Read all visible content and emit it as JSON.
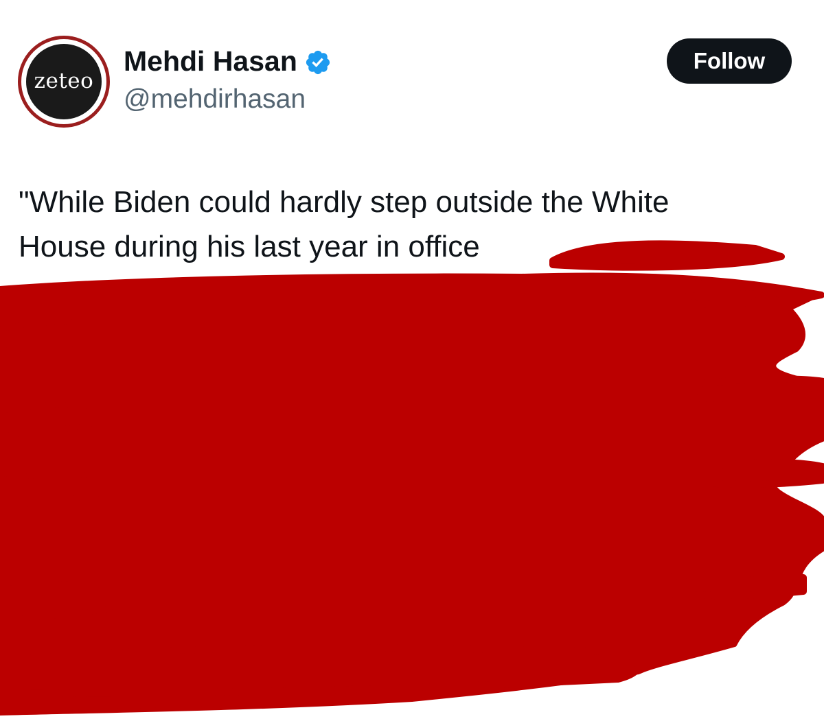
{
  "tweet": {
    "author": {
      "display_name": "Mehdi Hasan",
      "handle": "@mehdirhasan",
      "verified": true,
      "avatar_logo_text": "zeteo"
    },
    "follow_label": "Follow",
    "text_line_1": "\"While Biden could hardly step outside the White",
    "text_line_2": "House during his last year in office"
  },
  "colors": {
    "follow_button_bg": "#0f1419",
    "verified_badge": "#1d9bf0",
    "handle_text": "#536471",
    "redaction_marker": "#bb0000",
    "avatar_ring": "#9b1e1e"
  },
  "icons": {
    "verified": "verified-badge-icon"
  }
}
